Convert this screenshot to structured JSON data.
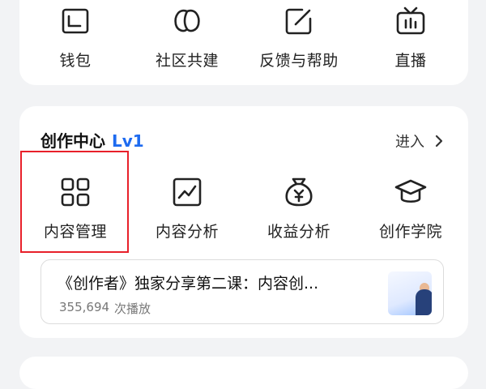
{
  "top_grid": {
    "items": [
      {
        "label": "钱包",
        "icon": "wallet-icon"
      },
      {
        "label": "社区共建",
        "icon": "leaf-icon"
      },
      {
        "label": "反馈与帮助",
        "icon": "edit-icon"
      },
      {
        "label": "直播",
        "icon": "tv-icon"
      }
    ]
  },
  "creator_center": {
    "title": "创作中心",
    "level": "Lv1",
    "enter_label": "进入",
    "tools": [
      {
        "label": "内容管理",
        "icon": "grid-icon",
        "highlighted": true
      },
      {
        "label": "内容分析",
        "icon": "chart-icon"
      },
      {
        "label": "收益分析",
        "icon": "money-bag-icon"
      },
      {
        "label": "创作学院",
        "icon": "graduation-cap-icon"
      }
    ],
    "featured_video": {
      "title": "《创作者》独家分享第二课：内容创...",
      "play_count": "355,694",
      "play_suffix": "次播放"
    }
  },
  "colors": {
    "background": "#f2f3f5",
    "card": "#ffffff",
    "level_blue": "#1e6bf0",
    "highlight_red": "#e8202a"
  }
}
